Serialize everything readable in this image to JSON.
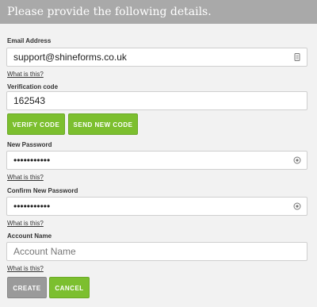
{
  "header": {
    "title": "Please provide the following details."
  },
  "email": {
    "label": "Email Address",
    "value": "support@shineforms.co.uk",
    "help": "What is this?",
    "icon": "contact-card-icon"
  },
  "verification": {
    "label": "Verification code",
    "value": "162543",
    "verify_button": "VERIFY CODE",
    "send_button": "SEND NEW CODE"
  },
  "new_password": {
    "label": "New Password",
    "value": "•••••••••••",
    "help": "What is this?",
    "icon": "password-visibility-icon"
  },
  "confirm_password": {
    "label": "Confirm New Password",
    "value": "•••••••••••",
    "help": "What is this?",
    "icon": "password-visibility-icon"
  },
  "account_name": {
    "label": "Account Name",
    "placeholder": "Account Name",
    "help": "What is this?"
  },
  "actions": {
    "create": "CREATE",
    "cancel": "CANCEL"
  },
  "colors": {
    "header_bg": "#a9a9a9",
    "green": "#7cbf2f",
    "grey_button": "#9a9a9a"
  }
}
